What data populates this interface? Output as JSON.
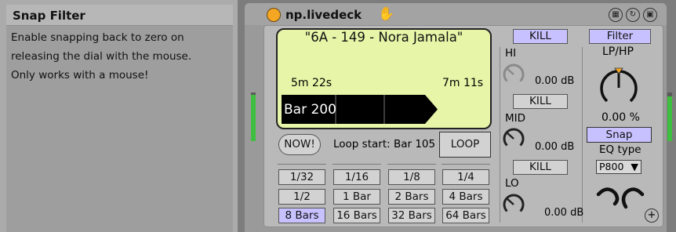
{
  "info_panel": {
    "title": "Snap Filter",
    "lines": [
      "Enable snapping back to zero on",
      "releasing the dial with the mouse.",
      "Only works with a mouse!"
    ]
  },
  "device": {
    "title": "np.livedeck",
    "icons": {
      "power": "power-icon",
      "hand": "hand-icon",
      "header": [
        "grip-icon",
        "refresh-icon",
        "save-icon"
      ],
      "add": "plus-icon"
    },
    "meters": {
      "left_level": 0.95,
      "right_level": 0.92
    },
    "track": {
      "name": "\"6A - 149 - Nora Jamala\"",
      "time_elapsed": "5m 22s",
      "time_remaining": "7m 11s",
      "bar": "Bar 200"
    },
    "now_label": "NOW!",
    "loop_start": "Loop start: Bar 105",
    "loop_label": "LOOP",
    "loop_lengths": [
      [
        "1/32",
        "1/16",
        "1/8",
        "1/4"
      ],
      [
        "1/2",
        "1 Bar",
        "2 Bars",
        "4 Bars"
      ],
      [
        "8 Bars",
        "16 Bars",
        "32 Bars",
        "64 Bars"
      ]
    ],
    "selected_length": "8 Bars",
    "eq": {
      "kill_all": "KILL",
      "bands": [
        {
          "label": "HI",
          "kill": "KILL",
          "value": "0.00 dB"
        },
        {
          "label": "MID",
          "kill": "KILL",
          "value": "0.00 dB"
        },
        {
          "label": "LO",
          "value": "0.00 dB"
        }
      ]
    },
    "filter": {
      "button": "Filter",
      "label": "LP/HP",
      "value": "0.00 %",
      "snap": "Snap",
      "eq_type_label": "EQ type",
      "eq_type": "P800"
    },
    "colors": {
      "display_bg": "#e6f5a7",
      "toggle_on": "#c7c2ff",
      "power": "#f5a623",
      "meter": "#3fbf3f"
    }
  }
}
